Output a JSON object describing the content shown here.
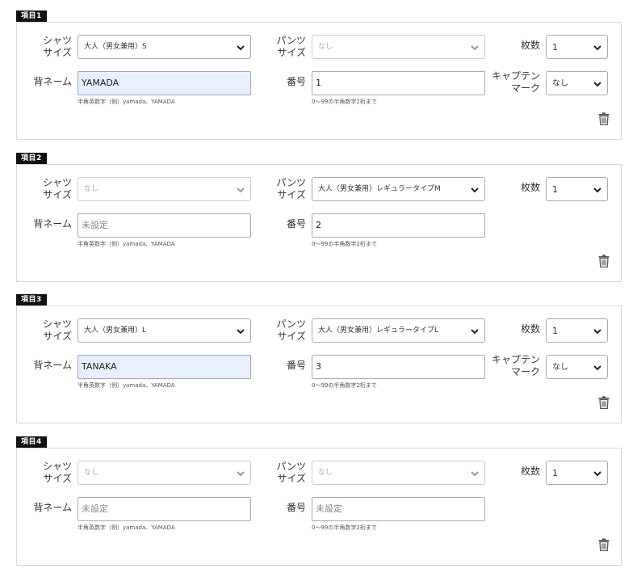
{
  "labels": {
    "shirt_size_1": "シャツ",
    "shirt_size_2": "サイズ",
    "pants_size_1": "パンツ",
    "pants_size_2": "サイズ",
    "count": "枚数",
    "back_name": "背ネーム",
    "number": "番号",
    "captain_1": "キャプテン",
    "captain_2": "マーク",
    "back_name_hint": "半角英数字（例）yamada、YAMADA",
    "number_hint": "0〜99の半角数字2桁まで"
  },
  "items": [
    {
      "title": "項目1",
      "shirt_size": "大人（男女兼用）S",
      "shirt_enabled": true,
      "pants_size": "なし",
      "pants_enabled": false,
      "count": "1",
      "back_name": "YAMADA",
      "back_name_placeholder": "",
      "number": "1",
      "number_placeholder": "",
      "captain_mark": "なし",
      "show_captain": true
    },
    {
      "title": "項目2",
      "shirt_size": "なし",
      "shirt_enabled": false,
      "pants_size": "大人（男女兼用）レギュラータイプM",
      "pants_enabled": true,
      "count": "1",
      "back_name": "",
      "back_name_placeholder": "未設定",
      "number": "2",
      "number_placeholder": "",
      "captain_mark": "",
      "show_captain": false
    },
    {
      "title": "項目3",
      "shirt_size": "大人（男女兼用）L",
      "shirt_enabled": true,
      "pants_size": "大人（男女兼用）レギュラータイプL",
      "pants_enabled": true,
      "count": "1",
      "back_name": "TANAKA",
      "back_name_placeholder": "",
      "number": "3",
      "number_placeholder": "",
      "captain_mark": "なし",
      "show_captain": true
    },
    {
      "title": "項目4",
      "shirt_size": "なし",
      "shirt_enabled": false,
      "pants_size": "なし",
      "pants_enabled": false,
      "count": "1",
      "back_name": "",
      "back_name_placeholder": "未設定",
      "number": "",
      "number_placeholder": "未設定",
      "captain_mark": "",
      "show_captain": false
    }
  ]
}
